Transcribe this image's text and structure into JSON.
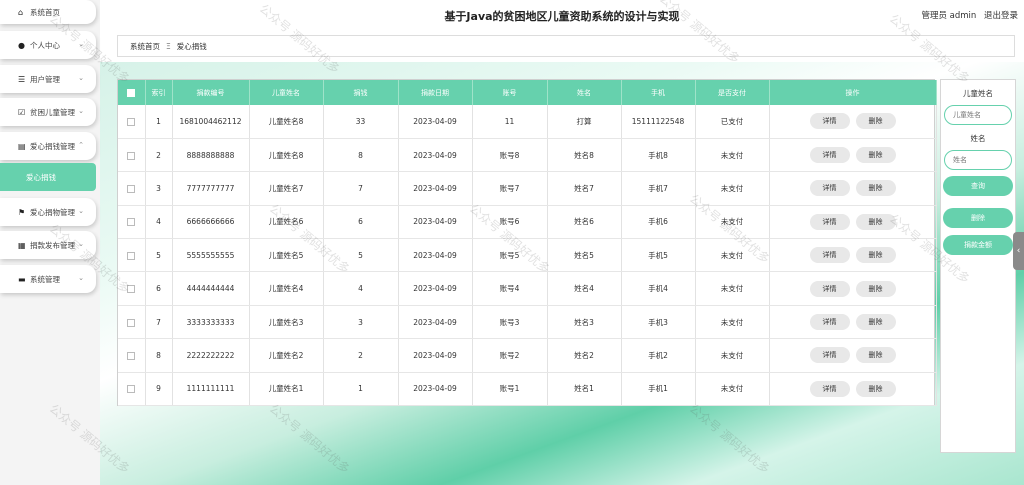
{
  "header": {
    "title": "基于Java的贫困地区儿童资助系统的设计与实现",
    "user": "管理员 admin",
    "logout": "退出登录"
  },
  "sidebar": {
    "items": [
      {
        "label": "系统首页",
        "icon": "home-icon",
        "glyph": "⌂",
        "chevron": false
      },
      {
        "label": "个人中心",
        "icon": "person-icon",
        "glyph": "●",
        "chevron": true
      },
      {
        "label": "用户管理",
        "icon": "list-icon",
        "glyph": "☰",
        "chevron": true
      },
      {
        "label": "贫困儿童管理",
        "icon": "checkbox-icon",
        "glyph": "☑",
        "chevron": true
      },
      {
        "label": "爱心捐钱管理",
        "icon": "document-icon",
        "glyph": "▤",
        "chevron": true
      },
      {
        "label": "爱心捐物管理",
        "icon": "flag-icon",
        "glyph": "⚑",
        "chevron": true
      },
      {
        "label": "捐款发布管理",
        "icon": "keyboard-icon",
        "glyph": "▦",
        "chevron": true
      },
      {
        "label": "系统管理",
        "icon": "computer-icon",
        "glyph": "▬",
        "chevron": true
      }
    ],
    "active_sub": "爱心捐钱"
  },
  "breadcrumb": {
    "home": "系统首页",
    "separator": "Ξ",
    "current": "爱心捐钱"
  },
  "table": {
    "columns": [
      "索引",
      "捐款编号",
      "儿童姓名",
      "捐钱",
      "捐款日期",
      "账号",
      "姓名",
      "手机",
      "是否支付",
      "操作"
    ],
    "detail_label": "详情",
    "delete_label": "删除",
    "rows": [
      {
        "index": "1",
        "code": "1681004462112",
        "child": "儿童姓名8",
        "amount": "33",
        "date": "2023-04-09",
        "account": "11",
        "name": "打算",
        "phone": "15111122548",
        "paid": "已支付"
      },
      {
        "index": "2",
        "code": "8888888888",
        "child": "儿童姓名8",
        "amount": "8",
        "date": "2023-04-09",
        "account": "账号8",
        "name": "姓名8",
        "phone": "手机8",
        "paid": "未支付"
      },
      {
        "index": "3",
        "code": "7777777777",
        "child": "儿童姓名7",
        "amount": "7",
        "date": "2023-04-09",
        "account": "账号7",
        "name": "姓名7",
        "phone": "手机7",
        "paid": "未支付"
      },
      {
        "index": "4",
        "code": "6666666666",
        "child": "儿童姓名6",
        "amount": "6",
        "date": "2023-04-09",
        "account": "账号6",
        "name": "姓名6",
        "phone": "手机6",
        "paid": "未支付"
      },
      {
        "index": "5",
        "code": "5555555555",
        "child": "儿童姓名5",
        "amount": "5",
        "date": "2023-04-09",
        "account": "账号5",
        "name": "姓名5",
        "phone": "手机5",
        "paid": "未支付"
      },
      {
        "index": "6",
        "code": "4444444444",
        "child": "儿童姓名4",
        "amount": "4",
        "date": "2023-04-09",
        "account": "账号4",
        "name": "姓名4",
        "phone": "手机4",
        "paid": "未支付"
      },
      {
        "index": "7",
        "code": "3333333333",
        "child": "儿童姓名3",
        "amount": "3",
        "date": "2023-04-09",
        "account": "账号3",
        "name": "姓名3",
        "phone": "手机3",
        "paid": "未支付"
      },
      {
        "index": "8",
        "code": "2222222222",
        "child": "儿童姓名2",
        "amount": "2",
        "date": "2023-04-09",
        "account": "账号2",
        "name": "姓名2",
        "phone": "手机2",
        "paid": "未支付"
      },
      {
        "index": "9",
        "code": "1111111111",
        "child": "儿童姓名1",
        "amount": "1",
        "date": "2023-04-09",
        "account": "账号1",
        "name": "姓名1",
        "phone": "手机1",
        "paid": "未支付"
      }
    ]
  },
  "search": {
    "child_label": "儿童姓名",
    "child_placeholder": "儿童姓名",
    "name_label": "姓名",
    "name_placeholder": "姓名",
    "query_button": "查询",
    "delete_button": "删除",
    "stats_button": "捐款金额"
  },
  "watermark": "公众号 源码好优多",
  "colors": {
    "accent": "#66d1ad"
  }
}
